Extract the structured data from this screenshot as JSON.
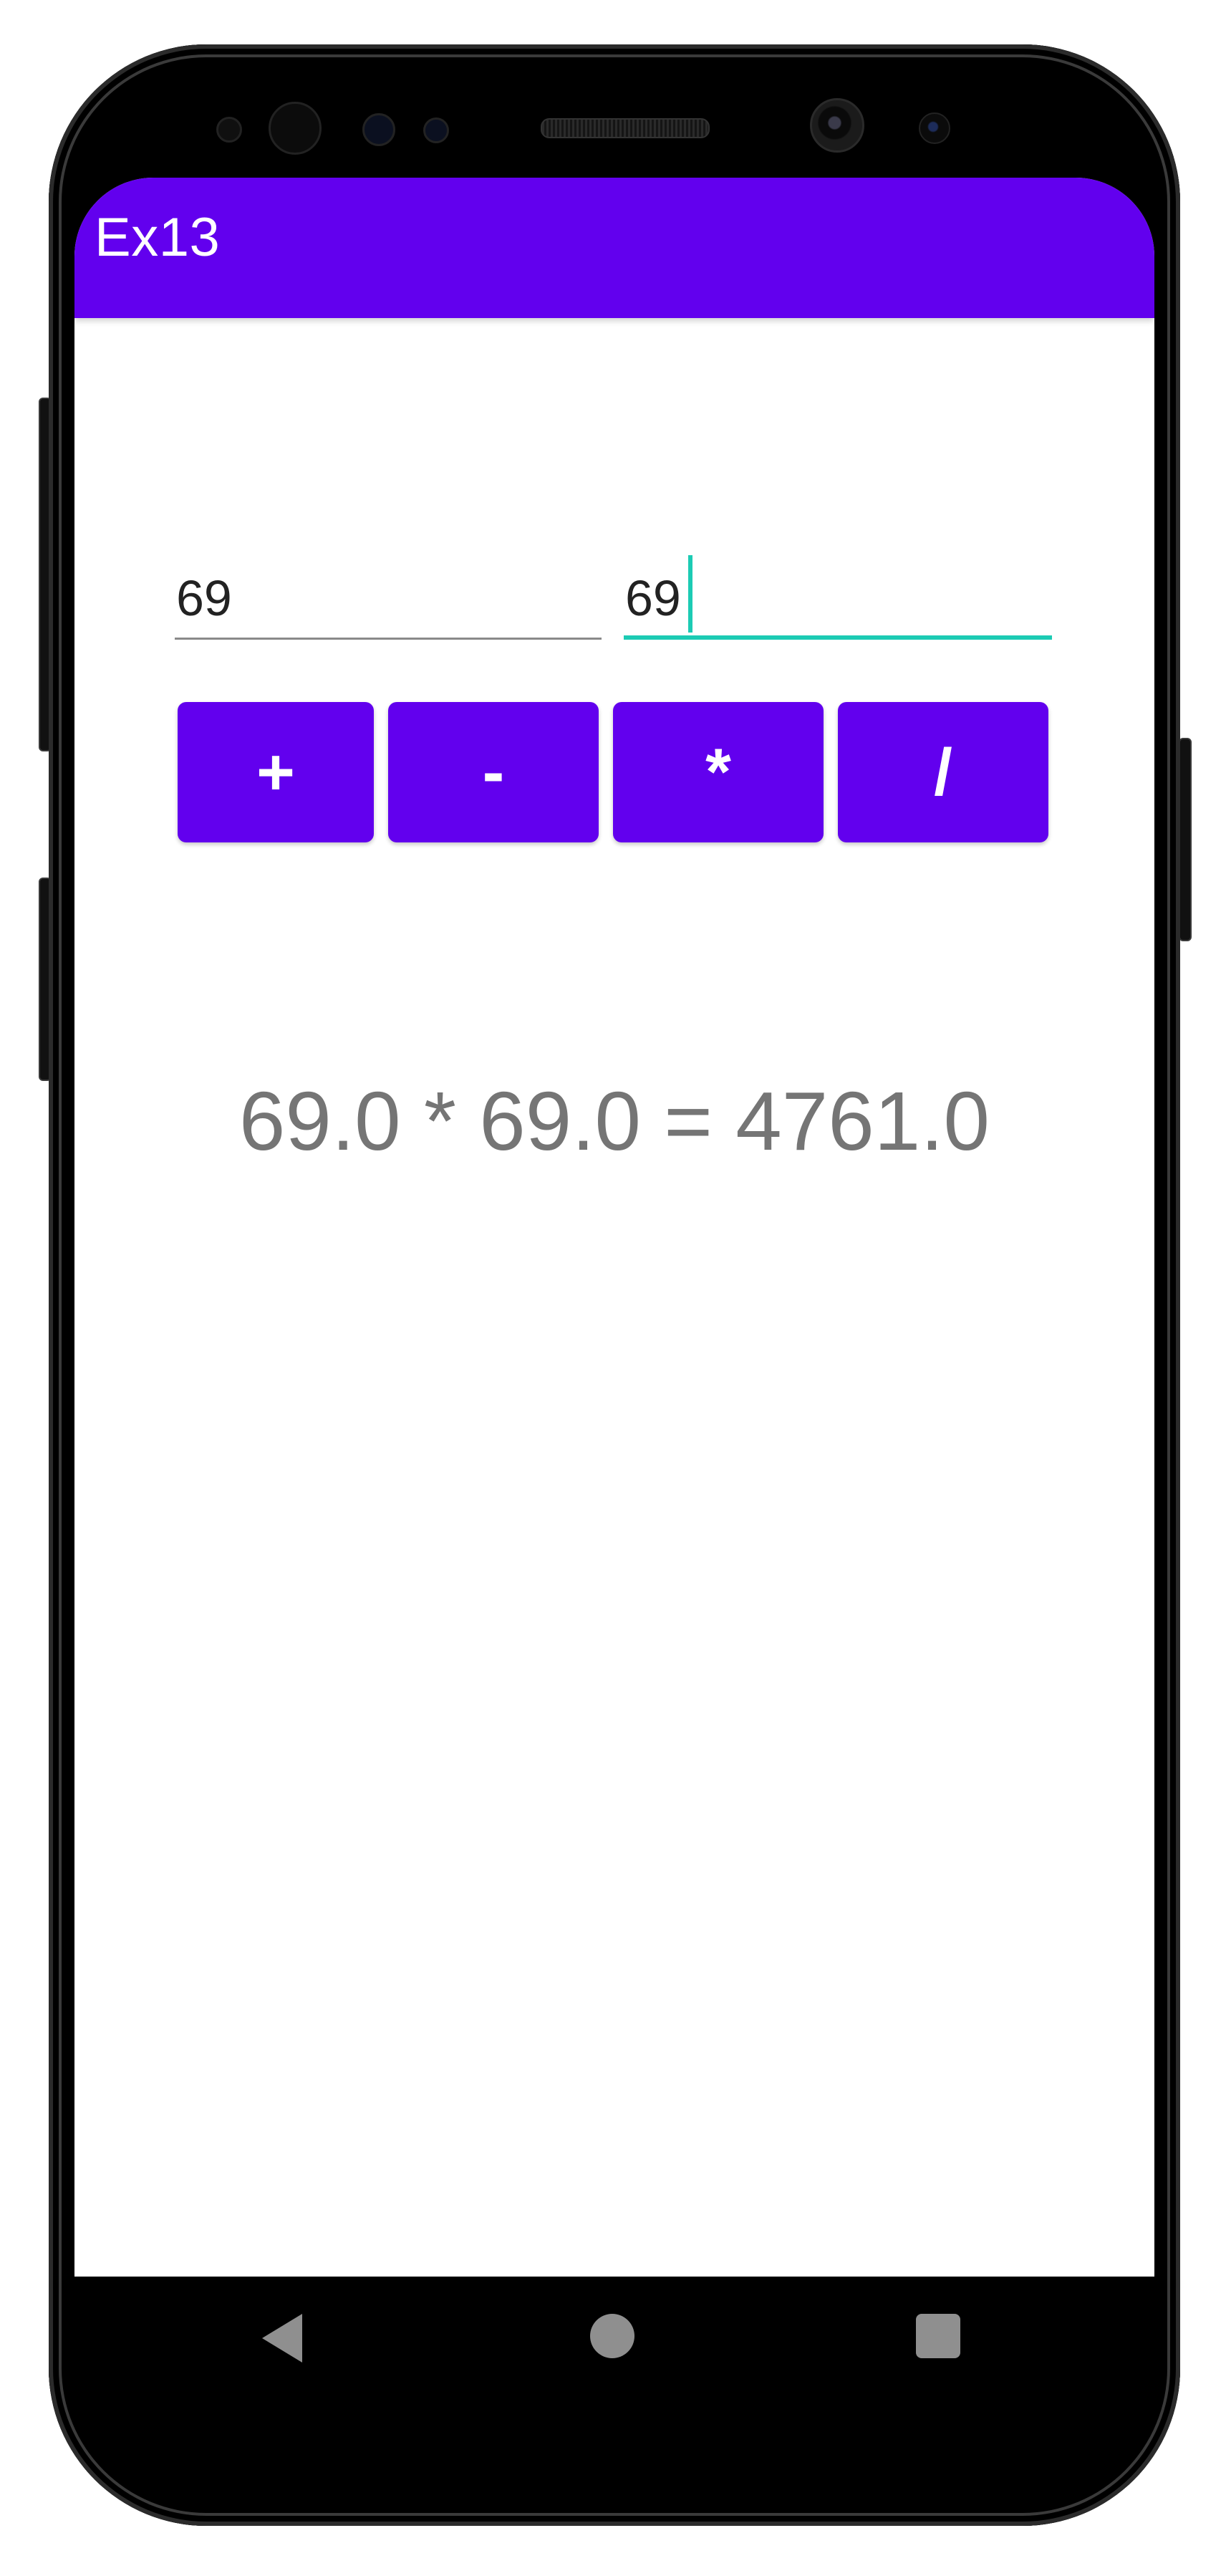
{
  "app": {
    "title": "Ex13"
  },
  "colors": {
    "primary": "#6200ee",
    "accent": "#1ccbb4",
    "result_text": "#757575"
  },
  "inputs": {
    "first": {
      "value": "69",
      "focused": false
    },
    "second": {
      "value": "69",
      "focused": true
    }
  },
  "operations": {
    "add_label": "+",
    "subtract_label": "-",
    "multiply_label": "*",
    "divide_label": "/"
  },
  "result": {
    "text": "69.0 * 69.0 = 4761.0"
  },
  "navigation": {
    "back_icon": "triangle-back-icon",
    "home_icon": "circle-home-icon",
    "recents_icon": "square-recents-icon"
  }
}
